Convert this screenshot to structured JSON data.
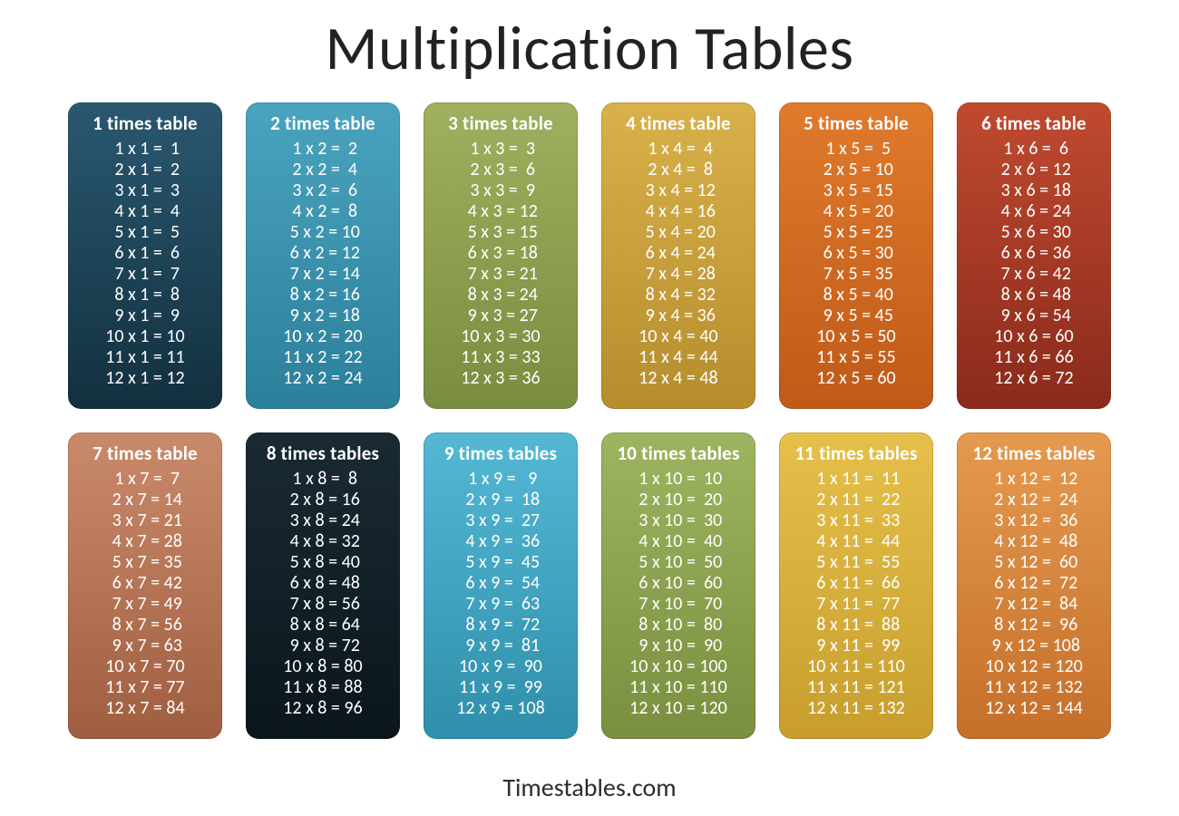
{
  "title": "Multiplication Tables",
  "footer": "Timestables.com",
  "chart_data": {
    "type": "table",
    "description": "Multiplication tables 1 through 12, each listing products for multipliers 1..12",
    "tables": [
      {
        "n": 1,
        "rows": [
          [
            1,
            1,
            1
          ],
          [
            2,
            1,
            2
          ],
          [
            3,
            1,
            3
          ],
          [
            4,
            1,
            4
          ],
          [
            5,
            1,
            5
          ],
          [
            6,
            1,
            6
          ],
          [
            7,
            1,
            7
          ],
          [
            8,
            1,
            8
          ],
          [
            9,
            1,
            9
          ],
          [
            10,
            1,
            10
          ],
          [
            11,
            1,
            11
          ],
          [
            12,
            1,
            12
          ]
        ]
      },
      {
        "n": 2,
        "rows": [
          [
            1,
            2,
            2
          ],
          [
            2,
            2,
            4
          ],
          [
            3,
            2,
            6
          ],
          [
            4,
            2,
            8
          ],
          [
            5,
            2,
            10
          ],
          [
            6,
            2,
            12
          ],
          [
            7,
            2,
            14
          ],
          [
            8,
            2,
            16
          ],
          [
            9,
            2,
            18
          ],
          [
            10,
            2,
            20
          ],
          [
            11,
            2,
            22
          ],
          [
            12,
            2,
            24
          ]
        ]
      },
      {
        "n": 3,
        "rows": [
          [
            1,
            3,
            3
          ],
          [
            2,
            3,
            6
          ],
          [
            3,
            3,
            9
          ],
          [
            4,
            3,
            12
          ],
          [
            5,
            3,
            15
          ],
          [
            6,
            3,
            18
          ],
          [
            7,
            3,
            21
          ],
          [
            8,
            3,
            24
          ],
          [
            9,
            3,
            27
          ],
          [
            10,
            3,
            30
          ],
          [
            11,
            3,
            33
          ],
          [
            12,
            3,
            36
          ]
        ]
      },
      {
        "n": 4,
        "rows": [
          [
            1,
            4,
            4
          ],
          [
            2,
            4,
            8
          ],
          [
            3,
            4,
            12
          ],
          [
            4,
            4,
            16
          ],
          [
            5,
            4,
            20
          ],
          [
            6,
            4,
            24
          ],
          [
            7,
            4,
            28
          ],
          [
            8,
            4,
            32
          ],
          [
            9,
            4,
            36
          ],
          [
            10,
            4,
            40
          ],
          [
            11,
            4,
            44
          ],
          [
            12,
            4,
            48
          ]
        ]
      },
      {
        "n": 5,
        "rows": [
          [
            1,
            5,
            5
          ],
          [
            2,
            5,
            10
          ],
          [
            3,
            5,
            15
          ],
          [
            4,
            5,
            20
          ],
          [
            5,
            5,
            25
          ],
          [
            6,
            5,
            30
          ],
          [
            7,
            5,
            35
          ],
          [
            8,
            5,
            40
          ],
          [
            9,
            5,
            45
          ],
          [
            10,
            5,
            50
          ],
          [
            11,
            5,
            55
          ],
          [
            12,
            5,
            60
          ]
        ]
      },
      {
        "n": 6,
        "rows": [
          [
            1,
            6,
            6
          ],
          [
            2,
            6,
            12
          ],
          [
            3,
            6,
            18
          ],
          [
            4,
            6,
            24
          ],
          [
            5,
            6,
            30
          ],
          [
            6,
            6,
            36
          ],
          [
            7,
            6,
            42
          ],
          [
            8,
            6,
            48
          ],
          [
            9,
            6,
            54
          ],
          [
            10,
            6,
            60
          ],
          [
            11,
            6,
            66
          ],
          [
            12,
            6,
            72
          ]
        ]
      },
      {
        "n": 7,
        "rows": [
          [
            1,
            7,
            7
          ],
          [
            2,
            7,
            14
          ],
          [
            3,
            7,
            21
          ],
          [
            4,
            7,
            28
          ],
          [
            5,
            7,
            35
          ],
          [
            6,
            7,
            42
          ],
          [
            7,
            7,
            49
          ],
          [
            8,
            7,
            56
          ],
          [
            9,
            7,
            63
          ],
          [
            10,
            7,
            70
          ],
          [
            11,
            7,
            77
          ],
          [
            12,
            7,
            84
          ]
        ]
      },
      {
        "n": 8,
        "rows": [
          [
            1,
            8,
            8
          ],
          [
            2,
            8,
            16
          ],
          [
            3,
            8,
            24
          ],
          [
            4,
            8,
            32
          ],
          [
            5,
            8,
            40
          ],
          [
            6,
            8,
            48
          ],
          [
            7,
            8,
            56
          ],
          [
            8,
            8,
            64
          ],
          [
            9,
            8,
            72
          ],
          [
            10,
            8,
            80
          ],
          [
            11,
            8,
            88
          ],
          [
            12,
            8,
            96
          ]
        ]
      },
      {
        "n": 9,
        "rows": [
          [
            1,
            9,
            9
          ],
          [
            2,
            9,
            18
          ],
          [
            3,
            9,
            27
          ],
          [
            4,
            9,
            36
          ],
          [
            5,
            9,
            45
          ],
          [
            6,
            9,
            54
          ],
          [
            7,
            9,
            63
          ],
          [
            8,
            9,
            72
          ],
          [
            9,
            9,
            81
          ],
          [
            10,
            9,
            90
          ],
          [
            11,
            9,
            99
          ],
          [
            12,
            9,
            108
          ]
        ]
      },
      {
        "n": 10,
        "rows": [
          [
            1,
            10,
            10
          ],
          [
            2,
            10,
            20
          ],
          [
            3,
            10,
            30
          ],
          [
            4,
            10,
            40
          ],
          [
            5,
            10,
            50
          ],
          [
            6,
            10,
            60
          ],
          [
            7,
            10,
            70
          ],
          [
            8,
            10,
            80
          ],
          [
            9,
            10,
            90
          ],
          [
            10,
            10,
            100
          ],
          [
            11,
            10,
            110
          ],
          [
            12,
            10,
            120
          ]
        ]
      },
      {
        "n": 11,
        "rows": [
          [
            1,
            11,
            11
          ],
          [
            2,
            11,
            22
          ],
          [
            3,
            11,
            33
          ],
          [
            4,
            11,
            44
          ],
          [
            5,
            11,
            55
          ],
          [
            6,
            11,
            66
          ],
          [
            7,
            11,
            77
          ],
          [
            8,
            11,
            88
          ],
          [
            9,
            11,
            99
          ],
          [
            10,
            11,
            110
          ],
          [
            11,
            11,
            121
          ],
          [
            12,
            11,
            132
          ]
        ]
      },
      {
        "n": 12,
        "rows": [
          [
            1,
            12,
            12
          ],
          [
            2,
            12,
            24
          ],
          [
            3,
            12,
            36
          ],
          [
            4,
            12,
            48
          ],
          [
            5,
            12,
            60
          ],
          [
            6,
            12,
            72
          ],
          [
            7,
            12,
            84
          ],
          [
            8,
            12,
            96
          ],
          [
            9,
            12,
            108
          ],
          [
            10,
            12,
            120
          ],
          [
            11,
            12,
            132
          ],
          [
            12,
            12,
            144
          ]
        ]
      }
    ]
  },
  "cards": [
    {
      "title": "1 times table",
      "color_top": "#2a5870",
      "color_bottom": "#12303f"
    },
    {
      "title": "2 times table",
      "color_top": "#4aa4bf",
      "color_bottom": "#2b7f9a"
    },
    {
      "title": "3 times table",
      "color_top": "#9fb05f",
      "color_bottom": "#7a8c3f"
    },
    {
      "title": "4 times table",
      "color_top": "#d9b14a",
      "color_bottom": "#b58d2d"
    },
    {
      "title": "5 times table",
      "color_top": "#e07a2c",
      "color_bottom": "#bf5a18"
    },
    {
      "title": "6 times table",
      "color_top": "#c04a30",
      "color_bottom": "#8a2a1c"
    },
    {
      "title": "7 times table",
      "color_top": "#c98a6b",
      "color_bottom": "#a05e40"
    },
    {
      "title": "8 times tables",
      "color_top": "#1a2a33",
      "color_bottom": "#0b161c"
    },
    {
      "title": "9 times tables",
      "color_top": "#54b8d4",
      "color_bottom": "#2f8fab"
    },
    {
      "title": "10 times tables",
      "color_top": "#9db460",
      "color_bottom": "#7a8f3f"
    },
    {
      "title": "11 times tables",
      "color_top": "#e6c04a",
      "color_bottom": "#c79e2d"
    },
    {
      "title": "12 times tables",
      "color_top": "#e59a4f",
      "color_bottom": "#c56f2a"
    }
  ]
}
